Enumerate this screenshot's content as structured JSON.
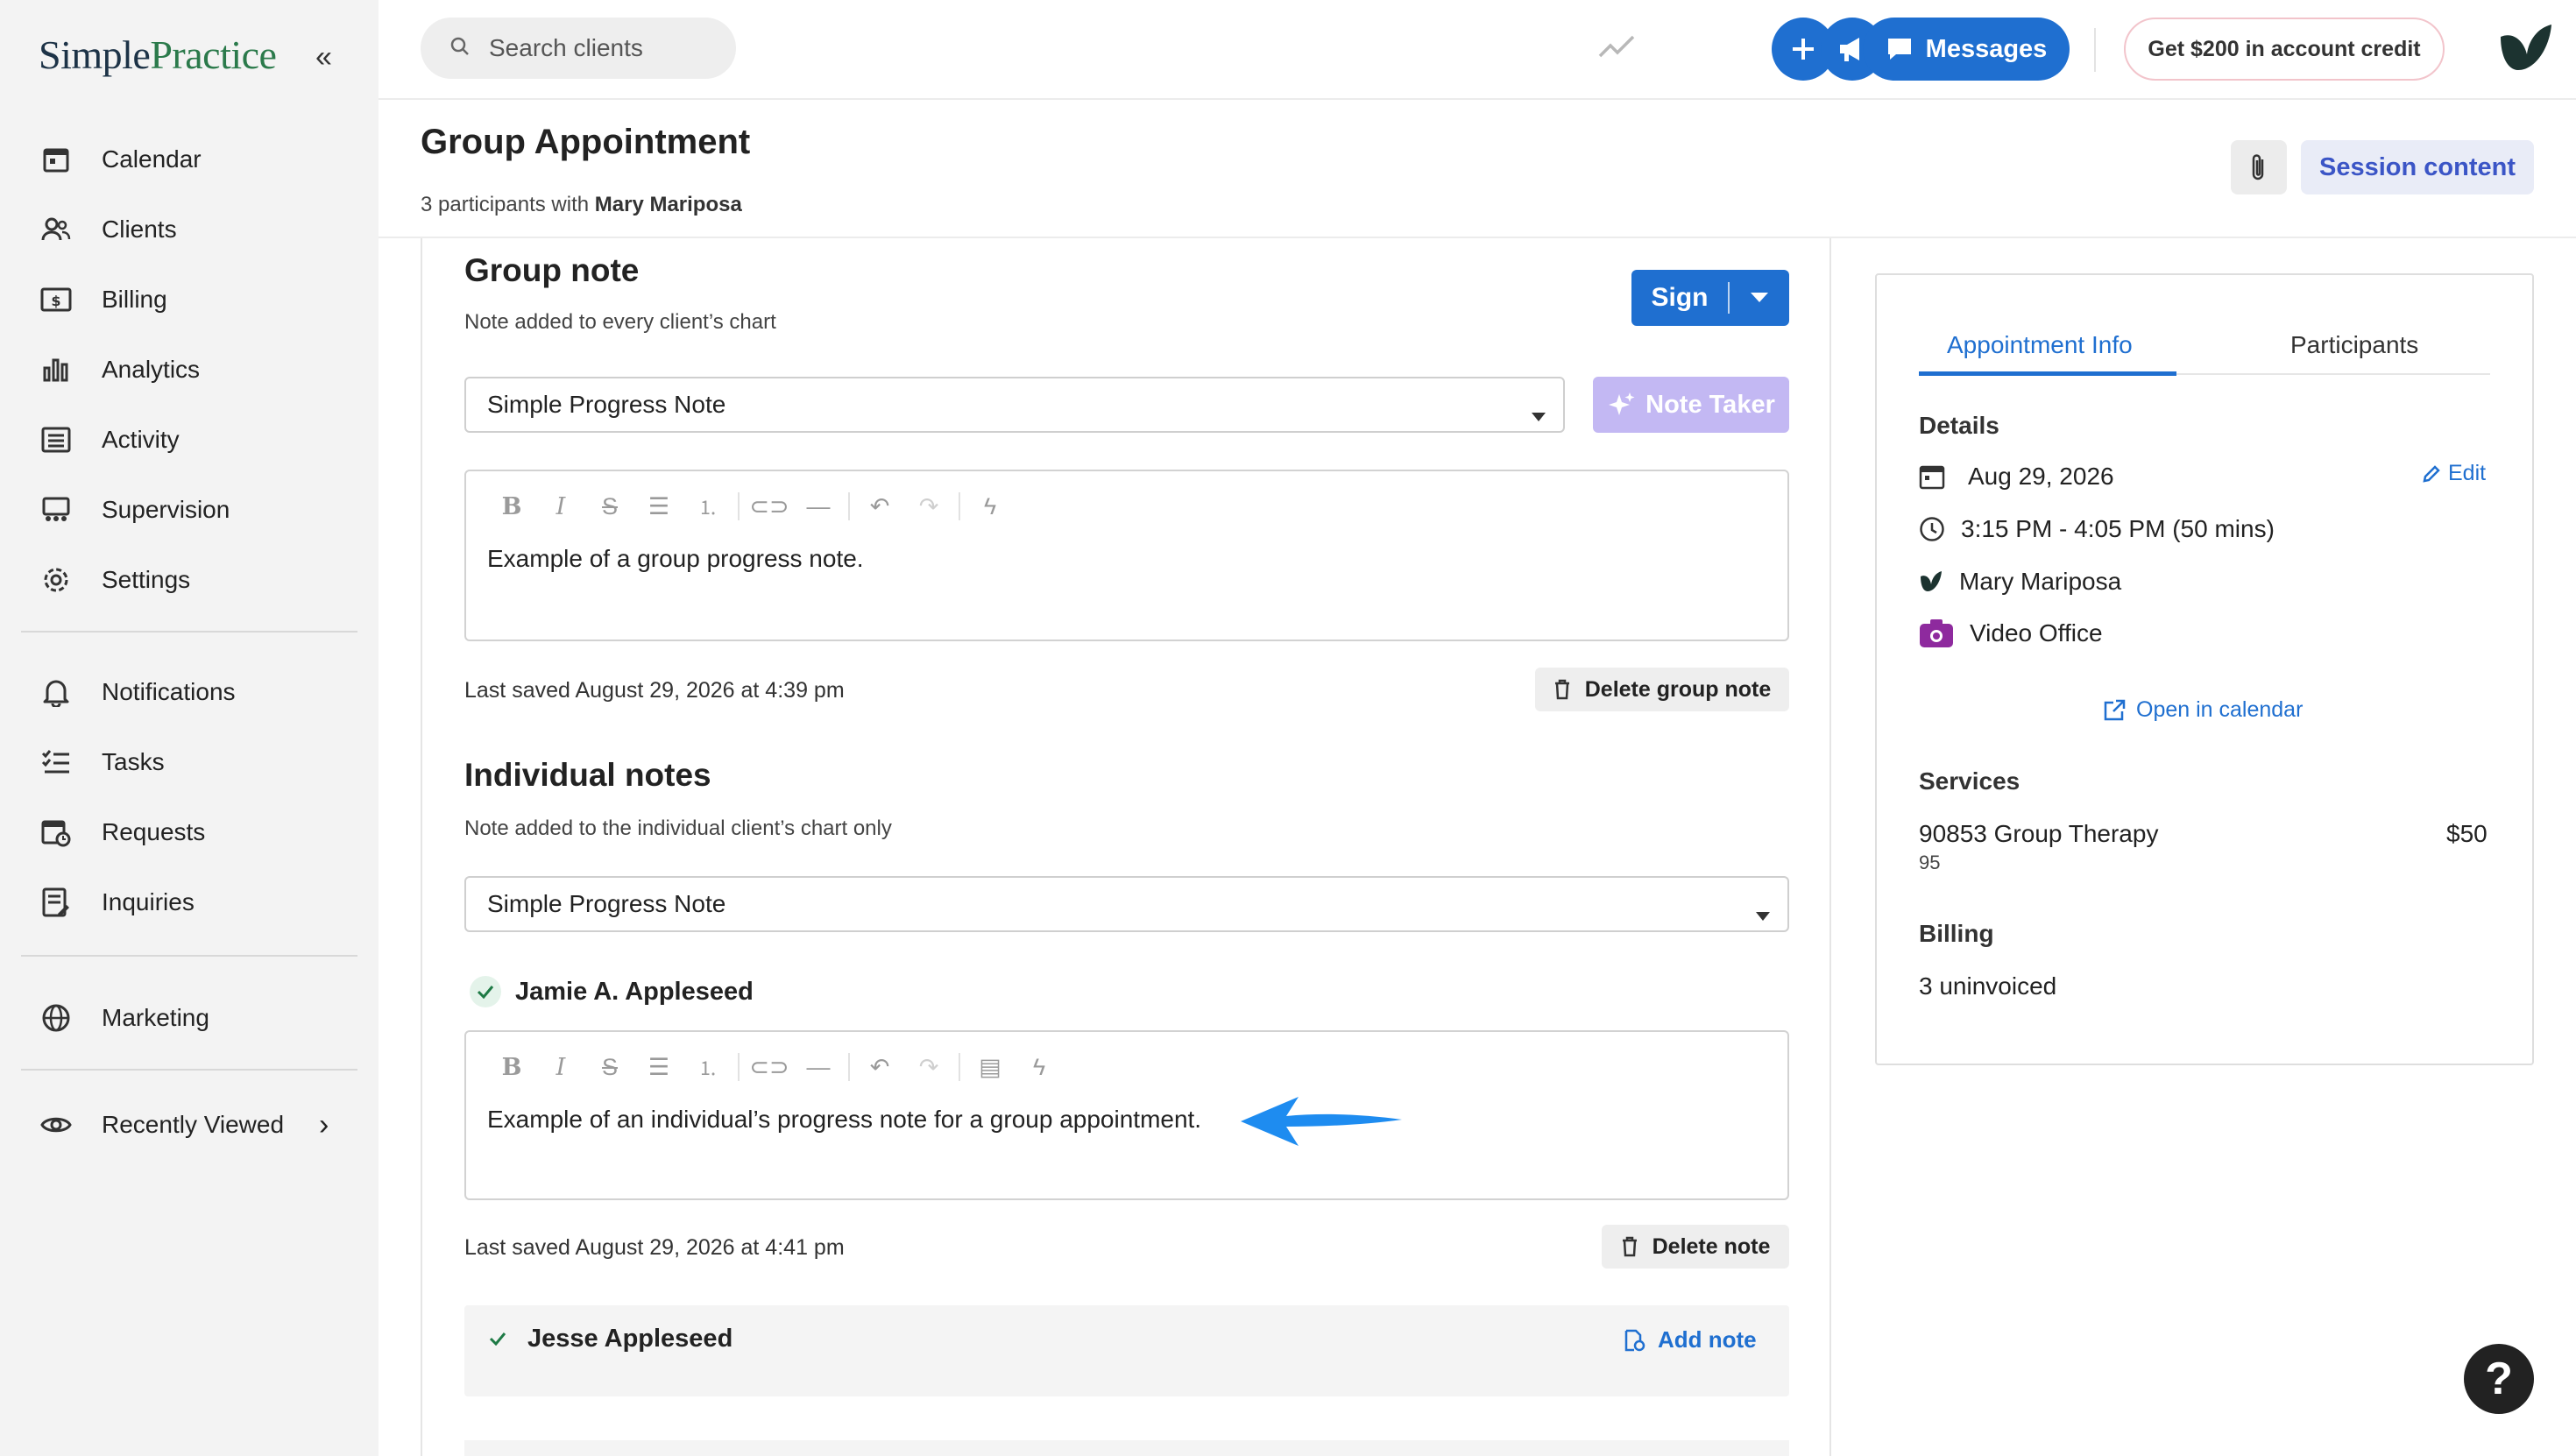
{
  "brand": {
    "logo_text_a": "Simple",
    "logo_text_b": "Practice"
  },
  "sidebar": {
    "collapse_icon": "double-chevron-left-icon",
    "items": [
      {
        "label": "Calendar",
        "icon": "calendar-icon"
      },
      {
        "label": "Clients",
        "icon": "users-icon"
      },
      {
        "label": "Billing",
        "icon": "billing-icon"
      },
      {
        "label": "Analytics",
        "icon": "bar-chart-icon"
      },
      {
        "label": "Activity",
        "icon": "activity-list-icon"
      },
      {
        "label": "Supervision",
        "icon": "supervision-icon"
      },
      {
        "label": "Settings",
        "icon": "gear-icon"
      },
      {
        "label": "Notifications",
        "icon": "bell-icon"
      },
      {
        "label": "Tasks",
        "icon": "tasks-icon"
      },
      {
        "label": "Requests",
        "icon": "calendar-request-icon"
      },
      {
        "label": "Inquiries",
        "icon": "inquiries-icon"
      },
      {
        "label": "Marketing",
        "icon": "globe-icon"
      },
      {
        "label": "Recently Viewed",
        "icon": "eye-icon"
      }
    ]
  },
  "topbar": {
    "search_placeholder": "Search clients",
    "messages_label": "Messages",
    "credit_label": "Get $200 in account credit"
  },
  "header": {
    "title": "Group Appointment",
    "subtitle_prefix": "3 participants with",
    "subtitle_name": "Mary Mariposa",
    "session_content_label": "Session content"
  },
  "group_note": {
    "title": "Group note",
    "subtitle": "Note added to every client’s chart",
    "sign_label": "Sign",
    "template": "Simple Progress Note",
    "note_taker_label": "Note Taker",
    "body": "Example of a group progress note.",
    "last_saved": "Last saved August 29, 2026 at 4:39 pm",
    "delete_label": "Delete group note"
  },
  "individual_notes": {
    "title": "Individual notes",
    "subtitle": "Note added to the individual client’s chart only",
    "template": "Simple Progress Note",
    "participants": [
      {
        "name": "Jamie A. Appleseed",
        "body": "Example of an individual’s progress note for a group appointment.",
        "last_saved": "Last saved August 29, 2026 at 4:41 pm",
        "delete_label": "Delete note"
      },
      {
        "name": "Jesse Appleseed",
        "add_note_label": "Add note"
      }
    ]
  },
  "panel": {
    "tabs": [
      "Appointment Info",
      "Participants"
    ],
    "active_tab": "Appointment Info",
    "details_heading": "Details",
    "edit_label": "Edit",
    "date": "Aug 29, 2026",
    "time": "3:15 PM - 4:05 PM (50 mins)",
    "clinician": "Mary Mariposa",
    "location": "Video Office",
    "open_calendar_label": "Open in calendar",
    "services_heading": "Services",
    "service_name": "90853 Group Therapy",
    "service_price": "$50",
    "service_units": "95",
    "billing_heading": "Billing",
    "billing_value": "3 uninvoiced"
  },
  "help_label": "?",
  "colors": {
    "primary": "#1f6fd0",
    "note_taker": "#c3b8f3",
    "video_office": "#8e2a9e",
    "arrow": "#1e8cf0"
  }
}
